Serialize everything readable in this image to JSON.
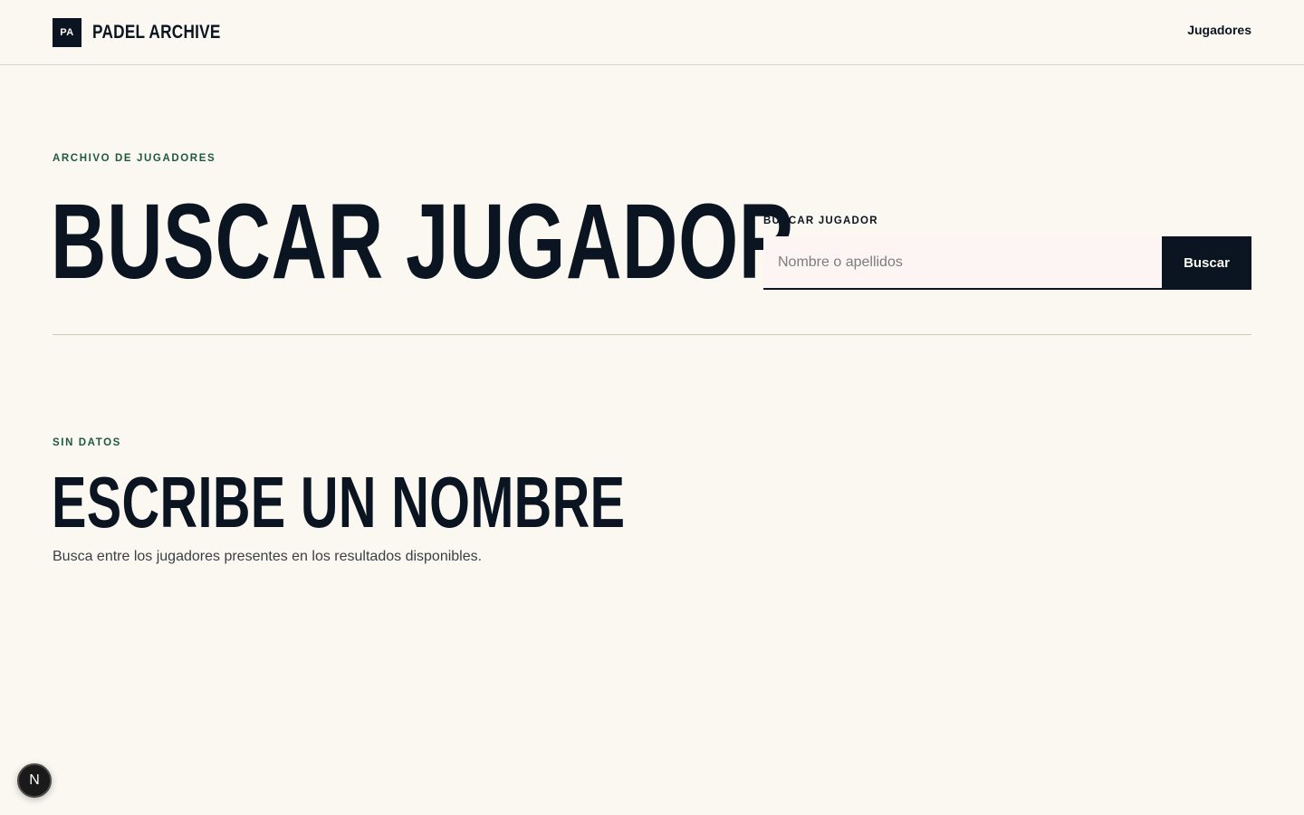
{
  "header": {
    "brand_mark": "PA",
    "brand_name": "PADEL ARCHIVE",
    "nav": [
      {
        "label": "Jugadores"
      }
    ]
  },
  "hero": {
    "eyebrow": "ARCHIVO DE JUGADORES",
    "title": "BUSCAR JUGADOR"
  },
  "search": {
    "label": "BUSCAR JUGADOR",
    "placeholder": "Nombre o apellidos",
    "value": "",
    "button_label": "Buscar"
  },
  "empty_state": {
    "eyebrow": "SIN DATOS",
    "title": "ESCRIBE UN NOMBRE",
    "description": "Busca entre los jugadores presentes en los resultados disponibles."
  },
  "dev_badge": {
    "letter": "N"
  },
  "colors": {
    "background": "#faf8f1",
    "ink": "#0b1522",
    "accent_green": "#1f5a3a",
    "input_background": "#fcf5f3"
  }
}
